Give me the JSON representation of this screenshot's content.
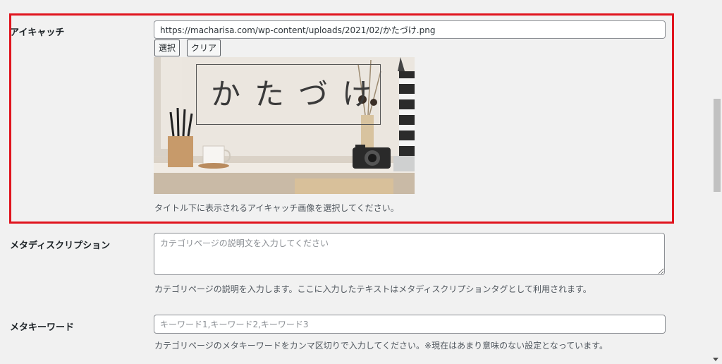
{
  "eyecatch": {
    "label": "アイキャッチ",
    "url_value": "https://macharisa.com/wp-content/uploads/2021/02/かたづけ.png",
    "select_button": "選択",
    "clear_button": "クリア",
    "image_text": "かたづけ",
    "description": "タイトル下に表示されるアイキャッチ画像を選択してください。"
  },
  "meta_description": {
    "label": "メタディスクリプション",
    "placeholder": "カテゴリページの説明文を入力してください",
    "description": "カテゴリページの説明を入力します。ここに入力したテキストはメタディスクリプションタグとして利用されます。"
  },
  "meta_keywords": {
    "label": "メタキーワード",
    "placeholder": "キーワード1,キーワード2,キーワード3",
    "description": "カテゴリページのメタキーワードをカンマ区切りで入力してください。※現在はあまり意味のない設定となっています。"
  },
  "colors": {
    "highlight": "#e0141e",
    "background": "#f1f1f1"
  }
}
